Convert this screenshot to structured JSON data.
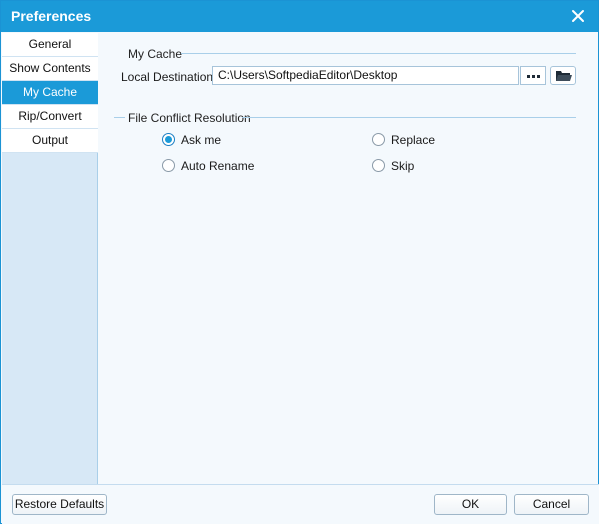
{
  "window": {
    "title": "Preferences"
  },
  "sidebar": {
    "items": [
      {
        "label": "General"
      },
      {
        "label": "Show Contents"
      },
      {
        "label": "My Cache"
      },
      {
        "label": "Rip/Convert"
      },
      {
        "label": "Output"
      }
    ],
    "selected": "My Cache"
  },
  "my_cache": {
    "group_title": "My Cache",
    "destination_label": "Local Destination:",
    "destination_value": "C:\\Users\\SoftpediaEditor\\Desktop"
  },
  "conflict": {
    "group_title": "File Conflict Resolution",
    "options": [
      {
        "label": "Ask me",
        "checked": true
      },
      {
        "label": "Replace",
        "checked": false
      },
      {
        "label": "Auto Rename",
        "checked": false
      },
      {
        "label": "Skip",
        "checked": false
      }
    ]
  },
  "footer": {
    "restore_label": "Restore Defaults",
    "ok_label": "OK",
    "cancel_label": "Cancel"
  },
  "colors": {
    "accent": "#1b9ad8",
    "sidebar_bg": "#d7e8f6",
    "content_bg": "#f4f9fd"
  }
}
